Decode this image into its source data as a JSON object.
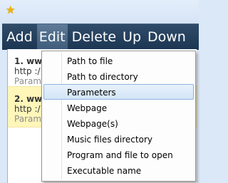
{
  "toolbar": {
    "items": [
      "Add",
      "Edit",
      "Delete",
      "Up",
      "Down"
    ],
    "active_index": 1
  },
  "list": {
    "entries": [
      {
        "title": "1. www",
        "url": "http :/",
        "params": "Param"
      },
      {
        "title": "2. www",
        "url": "http :/",
        "params": "Param"
      }
    ]
  },
  "menu": {
    "items": [
      "Path to file",
      "Path to directory",
      "Parameters",
      "Webpage",
      "Webpage(s)",
      "Music files directory",
      "Program and file to open",
      "Executable name"
    ],
    "hover_index": 2
  },
  "colors": {
    "toolbar_bg": "#1c3653",
    "highlight_row": "#fff6b9",
    "menu_hover": "#d4e5f8",
    "star": "#f0b400"
  },
  "icons": {
    "title_bar": "star-icon"
  }
}
